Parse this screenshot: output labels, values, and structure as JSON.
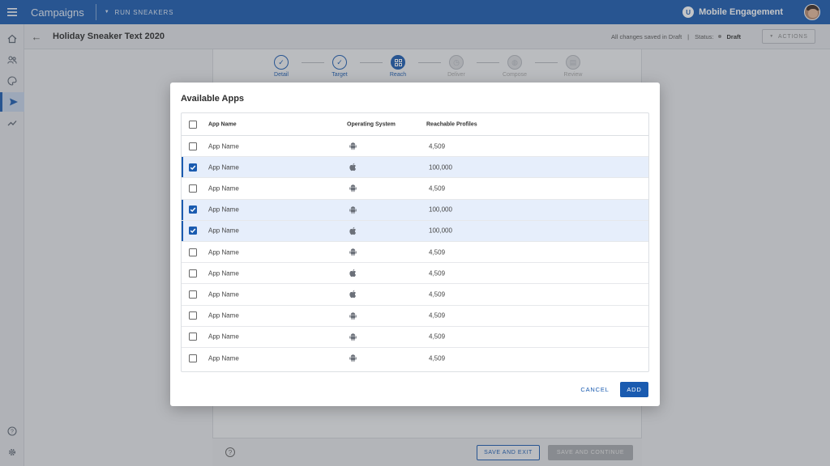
{
  "topbar": {
    "app_title": "Campaigns",
    "breadcrumb": "RUN SNEAKERS",
    "brand": "Mobile Engagement",
    "brand_logo_letter": "U"
  },
  "header": {
    "title": "Holiday Sneaker Text 2020",
    "saved_text": "All changes saved in Draft",
    "separator": "|",
    "status_label": "Status:",
    "status_value": "Draft",
    "actions_label": "ACTIONS"
  },
  "stepper": [
    {
      "label": "Detail",
      "state": "done",
      "icon": "check-icon"
    },
    {
      "label": "Target",
      "state": "done",
      "icon": "check-icon"
    },
    {
      "label": "Reach",
      "state": "current",
      "icon": "grid-icon"
    },
    {
      "label": "Deliver",
      "state": "future",
      "icon": "clock-icon"
    },
    {
      "label": "Compose",
      "state": "future",
      "icon": "palette-icon"
    },
    {
      "label": "Review",
      "state": "future",
      "icon": "document-icon"
    }
  ],
  "footer": {
    "save_exit": "SAVE AND EXIT",
    "save_continue": "SAVE AND CONTINUE"
  },
  "modal": {
    "title": "Available Apps",
    "columns": {
      "name": "App Name",
      "os": "Operating System",
      "reach": "Reachable Profiles"
    },
    "rows": [
      {
        "name": "App Name",
        "os": "android",
        "reach": "4,509",
        "checked": false
      },
      {
        "name": "App Name",
        "os": "apple",
        "reach": "100,000",
        "checked": true
      },
      {
        "name": "App Name",
        "os": "android",
        "reach": "4,509",
        "checked": false
      },
      {
        "name": "App Name",
        "os": "android",
        "reach": "100,000",
        "checked": true
      },
      {
        "name": "App Name",
        "os": "apple",
        "reach": "100,000",
        "checked": true
      },
      {
        "name": "App Name",
        "os": "android",
        "reach": "4,509",
        "checked": false
      },
      {
        "name": "App Name",
        "os": "apple",
        "reach": "4,509",
        "checked": false
      },
      {
        "name": "App Name",
        "os": "apple",
        "reach": "4,509",
        "checked": false
      },
      {
        "name": "App Name",
        "os": "android",
        "reach": "4,509",
        "checked": false
      },
      {
        "name": "App Name",
        "os": "android",
        "reach": "4,509",
        "checked": false
      },
      {
        "name": "App Name",
        "os": "android",
        "reach": "4,509",
        "checked": false
      }
    ],
    "cancel_label": "CANCEL",
    "add_label": "ADD"
  },
  "colors": {
    "primary": "#1a5bb0",
    "selected_row": "#e6eefb"
  }
}
